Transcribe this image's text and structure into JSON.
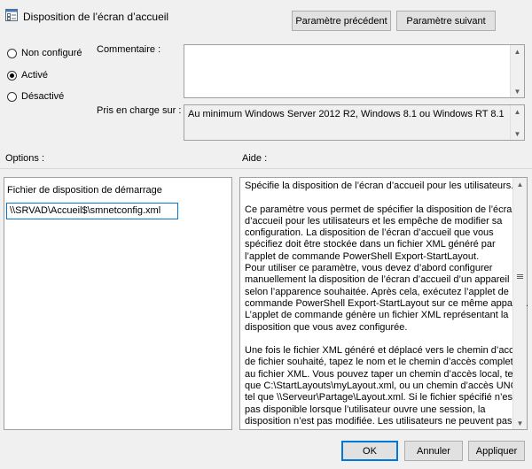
{
  "window": {
    "title": "Disposition de l’écran d’accueil",
    "icon": "policy-settings-icon"
  },
  "nav": {
    "prev_label": "Paramètre précédent",
    "next_label": "Paramètre suivant"
  },
  "state": {
    "options": [
      {
        "label": "Non configuré",
        "selected": false
      },
      {
        "label": "Activé",
        "selected": true
      },
      {
        "label": "Désactivé",
        "selected": false
      }
    ]
  },
  "comment": {
    "label": "Commentaire :",
    "value": ""
  },
  "supported": {
    "label": "Pris en charge sur :",
    "value": "Au minimum Windows Server 2012 R2, Windows 8.1 ou Windows RT 8.1"
  },
  "options_panel": {
    "header": "Options :",
    "field_label": "Fichier de disposition de démarrage",
    "field_value": "\\\\SRVAD\\Accueil$\\smnetconfig.xml"
  },
  "help_panel": {
    "header": "Aide :",
    "lines": [
      "Spécifie la disposition de l’écran d’accueil pour les utilisateurs.",
      "",
      "Ce paramètre vous permet de spécifier la disposition de l’écran",
      "d’accueil pour les utilisateurs et les empêche de modifier sa",
      "configuration. La disposition de l’écran d’accueil que vous",
      "spécifiez doit être stockée dans un fichier XML généré par",
      "l’applet de commande PowerShell Export-StartLayout.",
      "Pour utiliser ce paramètre, vous devez d’abord configurer",
      "manuellement la disposition de l’écran d’accueil d’un appareil",
      "selon l’apparence souhaitée. Après cela, exécutez l’applet de",
      "commande PowerShell Export-StartLayout sur ce même appareil.",
      "L’applet de commande génère un fichier XML représentant la",
      "disposition que vous avez configurée.",
      "",
      "Une fois le fichier XML généré et déplacé vers le chemin d’accès",
      "de fichier souhaité, tapez le nom et le chemin d’accès complet",
      "au fichier XML. Vous pouvez taper un chemin d’accès local, tel",
      "que C:\\StartLayouts\\myLayout.xml, ou un chemin d’accès UNC,",
      "tel que \\\\Serveur\\Partage\\Layout.xml. Si le fichier spécifié n’est",
      "pas disponible lorsque l’utilisateur ouvre une session, la",
      "disposition n’est pas modifiée. Les utilisateurs ne peuvent pas"
    ]
  },
  "footer": {
    "ok_label": "OK",
    "cancel_label": "Annuler",
    "apply_label": "Appliquer"
  }
}
